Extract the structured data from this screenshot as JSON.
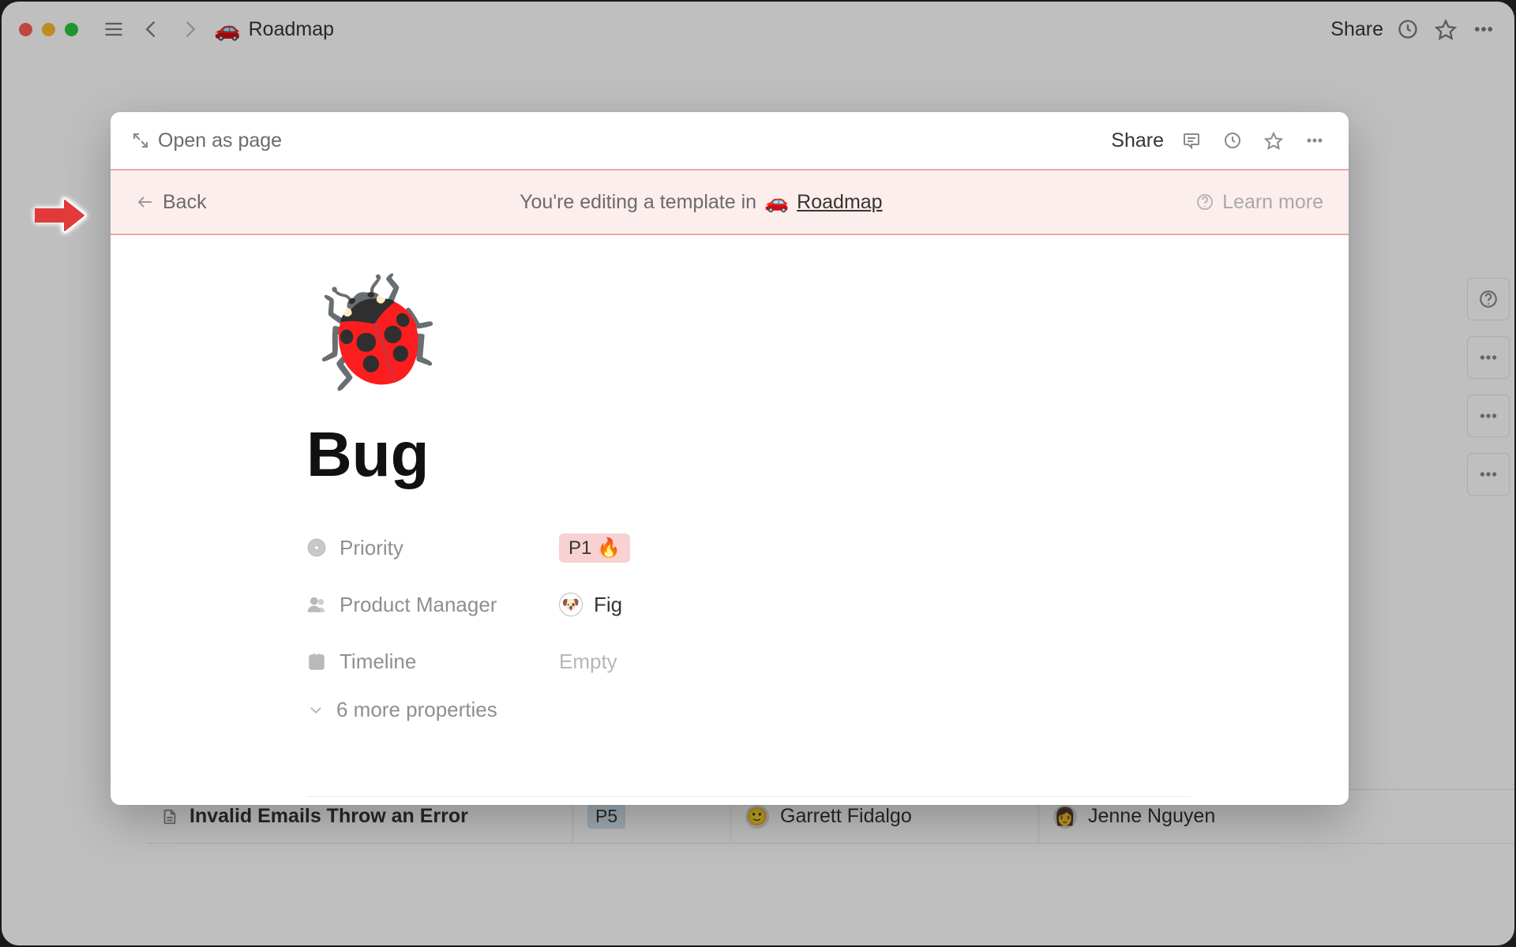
{
  "topbar": {
    "breadcrumb_emoji": "🚗",
    "breadcrumb_title": "Roadmap",
    "share_label": "Share"
  },
  "bg_table": {
    "row": {
      "title": "Invalid Emails Throw an Error",
      "priority": "P5",
      "pm": "Garrett Fidalgo",
      "engineer": "Jenne Nguyen"
    }
  },
  "modal": {
    "open_as_page": "Open as page",
    "share_label": "Share",
    "banner": {
      "back_label": "Back",
      "text_prefix": "You're editing a template in",
      "link_emoji": "🚗",
      "link_text": "Roadmap",
      "learn_more": "Learn more"
    },
    "page_icon": "🐞",
    "page_title": "Bug",
    "properties": {
      "priority": {
        "label": "Priority",
        "value": "P1 🔥"
      },
      "pm": {
        "label": "Product Manager",
        "value": "Fig"
      },
      "timeline": {
        "label": "Timeline",
        "value": "Empty"
      }
    },
    "more_properties_label": "6 more properties"
  }
}
